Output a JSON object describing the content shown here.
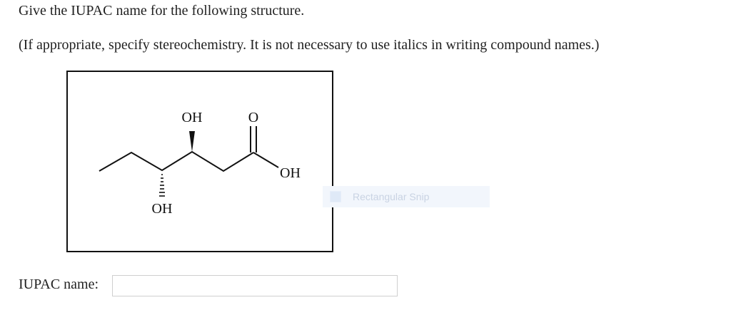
{
  "question": {
    "prompt": "Give the IUPAC name for the following structure.",
    "instructions": "(If appropriate, specify stereochemistry. It is not necessary to use italics in writing compound names.)"
  },
  "structure": {
    "labels": {
      "top_hydroxyl": "OH",
      "carbonyl_oxygen": "O",
      "acid_hydroxyl": "OH",
      "bottom_hydroxyl": "OH"
    }
  },
  "overlay": {
    "text": "Rectangular Snip",
    "icon": "snip-icon"
  },
  "answer": {
    "label": "IUPAC name:",
    "value": "",
    "placeholder": ""
  }
}
